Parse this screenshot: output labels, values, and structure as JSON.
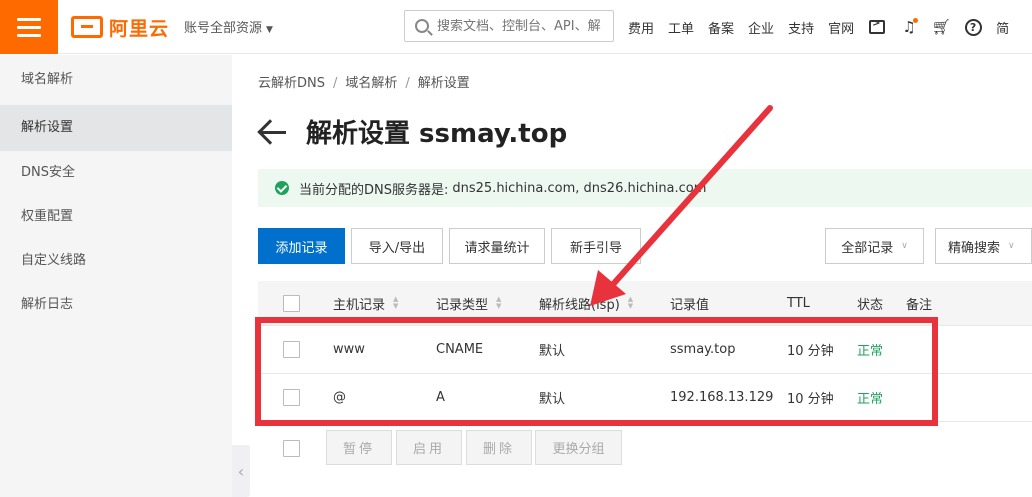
{
  "header": {
    "logo_text": "阿里云",
    "account_label": "账号全部资源",
    "search_placeholder": "搜索文档、控制台、API、解",
    "nav": [
      "费用",
      "工单",
      "备案",
      "企业",
      "支持",
      "官网"
    ],
    "trailing_label": "简"
  },
  "sidebar": {
    "items": [
      "域名解析",
      "解析设置",
      "DNS安全",
      "权重配置",
      "自定义线路",
      "解析日志"
    ],
    "active": "解析设置"
  },
  "breadcrumb": [
    "云解析DNS",
    "域名解析",
    "解析设置"
  ],
  "page_title": "解析设置 ssmay.top",
  "alert": {
    "label": "当前分配的DNS服务器是:",
    "value": "dns25.hichina.com, dns26.hichina.com"
  },
  "toolbar": {
    "add_record": "添加记录",
    "import_export": "导入/导出",
    "request_stats": "请求量统计",
    "guide": "新手引导",
    "filter_all": "全部记录",
    "precise_search": "精确搜索"
  },
  "table": {
    "columns": [
      "主机记录",
      "记录类型",
      "解析线路(isp)",
      "记录值",
      "TTL",
      "状态",
      "备注"
    ],
    "rows": [
      {
        "host": "www",
        "type": "CNAME",
        "line": "默认",
        "value": "ssmay.top",
        "ttl": "10 分钟",
        "status": "正常"
      },
      {
        "host": "@",
        "type": "A",
        "line": "默认",
        "value": "192.168.13.129",
        "ttl": "10 分钟",
        "status": "正常"
      }
    ]
  },
  "batch": {
    "pause": "暂停",
    "enable": "启用",
    "delete": "删除",
    "change_group": "更换分组"
  },
  "colors": {
    "brand": "#ff6a00",
    "primary": "#0070cc",
    "success": "#1ea35c",
    "annotation": "#e8323c"
  }
}
